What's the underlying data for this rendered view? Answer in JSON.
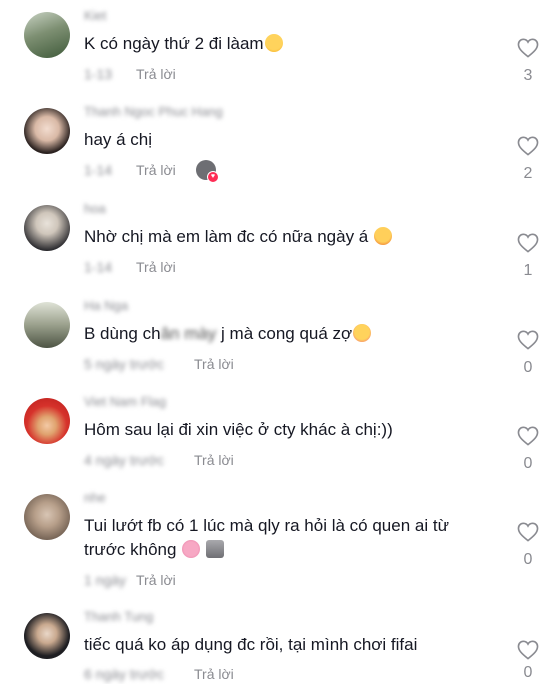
{
  "reply_label": "Trả lời",
  "comments": [
    {
      "username": "Kiet",
      "text": "K có ngày thứ 2 đi làam",
      "date": "1-13",
      "likes": "3"
    },
    {
      "username": "Thanh Ngoc Phuc Hang",
      "text": "hay á chị",
      "date": "1-14",
      "likes": "2"
    },
    {
      "username": "hoa",
      "text": "Nhờ chị mà em làm đc có nữa ngày á",
      "date": "1-14",
      "likes": "1"
    },
    {
      "username": "Ha Nga",
      "text_before": "B dùng ch",
      "text_after": " j mà cong quá zợ",
      "date": "5 ngày trước",
      "likes": "0"
    },
    {
      "username": "Viet Nam Flag",
      "text": "Hôm sau lại đi xin việc ở cty khác à chị:))",
      "date": "4 ngày trước",
      "likes": "0"
    },
    {
      "username": "nhe",
      "text": "Tui lướt fb có 1 lúc mà qly ra hỏi là có quen ai từ trước không",
      "date": "1 ngày",
      "likes": "0"
    },
    {
      "username": "Thanh Tung",
      "text": "tiếc quá ko áp dụng đc rồi, tại mình chơi fifai",
      "date": "6 ngày trước",
      "likes": "0"
    }
  ]
}
